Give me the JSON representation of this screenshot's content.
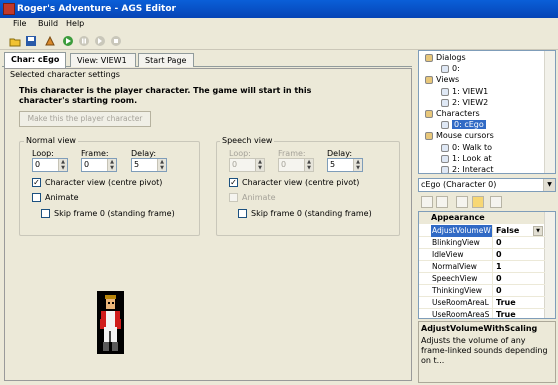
{
  "window": {
    "title": "Roger's Adventure - AGS Editor"
  },
  "menu": [
    "File",
    "Build",
    "Help"
  ],
  "toolbar": {
    "icons": [
      "open-icon",
      "save-icon",
      "build-icon",
      "run-icon",
      "pause-icon",
      "step-icon",
      "stop-icon"
    ]
  },
  "tabs": [
    {
      "label": "Char: cEgo",
      "active": true
    },
    {
      "label": "View: VIEW1",
      "active": false
    },
    {
      "label": "Start Page",
      "active": false
    }
  ],
  "tab_tools": {
    "pin": "▾",
    "close": "✕"
  },
  "settings": {
    "group_title": "Selected character settings",
    "player_text": "This character is the player character. The game will start in this character's starting room.",
    "make_player_button": "Make this the player character",
    "normal_view": {
      "legend": "Normal view",
      "loop_label": "Loop:",
      "frame_label": "Frame:",
      "delay_label": "Delay:",
      "loop": "0",
      "frame": "0",
      "delay": "5",
      "character_view": "Character view (centre pivot)",
      "character_view_checked": true,
      "animate": "Animate",
      "animate_checked": false,
      "skip_frame": "Skip frame 0 (standing frame)",
      "skip_checked": false
    },
    "speech_view": {
      "legend": "Speech view",
      "loop_label": "Loop:",
      "frame_label": "Frame:",
      "delay_label": "Delay:",
      "loop": "0",
      "frame": "0",
      "delay": "5",
      "character_view": "Character view (centre pivot)",
      "character_view_checked": true,
      "animate": "Animate",
      "animate_checked": false,
      "skip_frame": "Skip frame 0 (standing frame)",
      "skip_checked": false
    }
  },
  "tree": [
    {
      "label": "Dialogs",
      "indent": 0,
      "icon": "dialog-icon"
    },
    {
      "label": "0:",
      "indent": 1,
      "icon": "dialog-item-icon"
    },
    {
      "label": "Views",
      "indent": 0,
      "icon": "views-icon"
    },
    {
      "label": "1: VIEW1",
      "indent": 1,
      "icon": "view-item-icon"
    },
    {
      "label": "2: VIEW2",
      "indent": 1,
      "icon": "view-item-icon"
    },
    {
      "label": "Characters",
      "indent": 0,
      "icon": "characters-icon"
    },
    {
      "label": "0: cEgo",
      "indent": 1,
      "icon": "character-item-icon",
      "selected": true
    },
    {
      "label": "Mouse cursors",
      "indent": 0,
      "icon": "cursor-icon"
    },
    {
      "label": "0: Walk to",
      "indent": 1,
      "icon": "cursor-item-icon"
    },
    {
      "label": "1: Look at",
      "indent": 1,
      "icon": "cursor-item-icon"
    },
    {
      "label": "2: Interact",
      "indent": 1,
      "icon": "cursor-item-icon"
    }
  ],
  "object_combo": "cEgo (Character 0)",
  "property_grid": {
    "category": "Appearance",
    "rows": [
      {
        "name": "AdjustVolumeW",
        "value": "False",
        "selected": true
      },
      {
        "name": "BlinkingView",
        "value": "0"
      },
      {
        "name": "IdleView",
        "value": "0"
      },
      {
        "name": "NormalView",
        "value": "1"
      },
      {
        "name": "SpeechView",
        "value": "0"
      },
      {
        "name": "ThinkingView",
        "value": "0"
      },
      {
        "name": "UseRoomAreaL",
        "value": "True"
      },
      {
        "name": "UseRoomAreaS",
        "value": "True"
      }
    ]
  },
  "description": {
    "title": "AdjustVolumeWithScaling",
    "text": "Adjusts the volume of any frame-linked sounds depending on t..."
  }
}
